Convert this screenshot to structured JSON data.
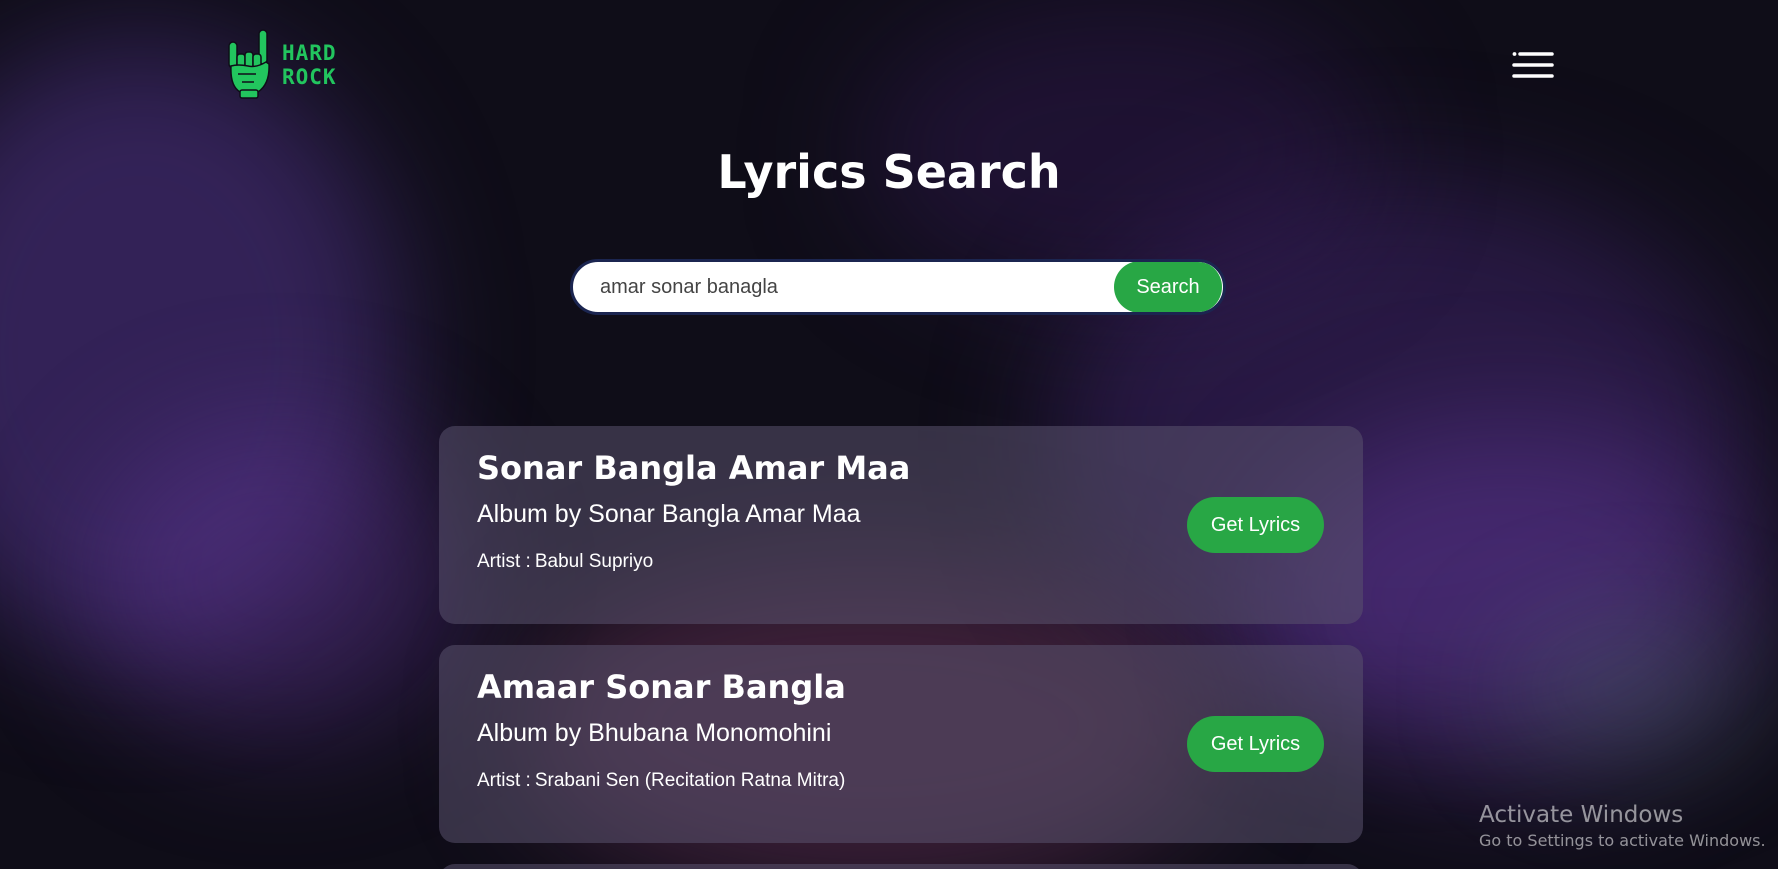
{
  "app": {
    "logo_text": [
      "HARD",
      "ROCK"
    ],
    "logo_color": "#22c55e",
    "logo_icon": "rock-hand-icon"
  },
  "header": {
    "menu_icon": "hamburger-menu-icon",
    "title": "Lyrics Search"
  },
  "search": {
    "value": "amar sonar banagla",
    "button_label": "Search",
    "accent": "#28a745"
  },
  "results": [
    {
      "title": "Sonar Bangla Amar Maa",
      "album": "Album by Sonar Bangla Amar Maa",
      "artist_prefix": "Artist :",
      "artist": "Babul Supriyo",
      "button_label": "Get Lyrics"
    },
    {
      "title": "Amaar Sonar Bangla",
      "album": "Album by Bhubana Monomohini",
      "artist_prefix": "Artist :",
      "artist": "Srabani Sen (Recitation Ratna Mitra)",
      "button_label": "Get Lyrics"
    }
  ],
  "watermark": {
    "title": "Activate Windows",
    "subtitle": "Go to Settings to activate Windows."
  }
}
